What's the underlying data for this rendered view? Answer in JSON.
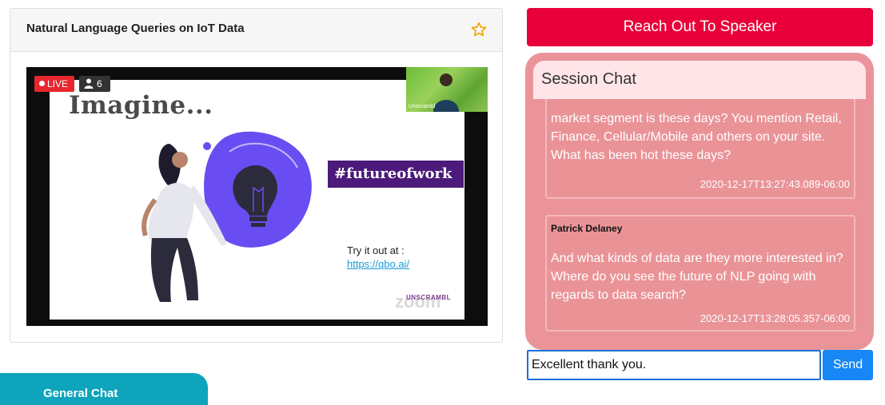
{
  "session": {
    "title": "Natural Language Queries on IoT Data",
    "live_label": "LIVE",
    "viewer_count": "6",
    "slide": {
      "heading": "Imagine...",
      "hashtag": "#futureofwork",
      "try_label": "Try it out at :",
      "link": "https://qbo.ai/",
      "zoom_label": "zoom",
      "brand": "UNSCRAMBL"
    },
    "speaker_label": "Unscrambl"
  },
  "reach_button": "Reach Out To Speaker",
  "chat": {
    "heading": "Session Chat",
    "messages": [
      {
        "author": "",
        "text": "market segment is these days? You mention Retail, Finance, Cellular/Mobile and others on your site. What has been hot these days?",
        "time": "2020-12-17T13:27:43.089-06:00"
      },
      {
        "author": "Patrick Delaney",
        "text": "And what kinds of data are they more interested in? Where do you see the future of NLP going with regards to data search?",
        "time": "2020-12-17T13:28:05.357-06:00"
      }
    ],
    "input_value": "Excellent thank you.",
    "send_label": "Send"
  },
  "general_chat_tab": "General Chat",
  "colors": {
    "reach_button": "#e9003a",
    "chat_panel": "#ea949a",
    "send_button": "#1787f5",
    "general_tab": "#0ea4bb",
    "live_badge": "#e8262d"
  }
}
